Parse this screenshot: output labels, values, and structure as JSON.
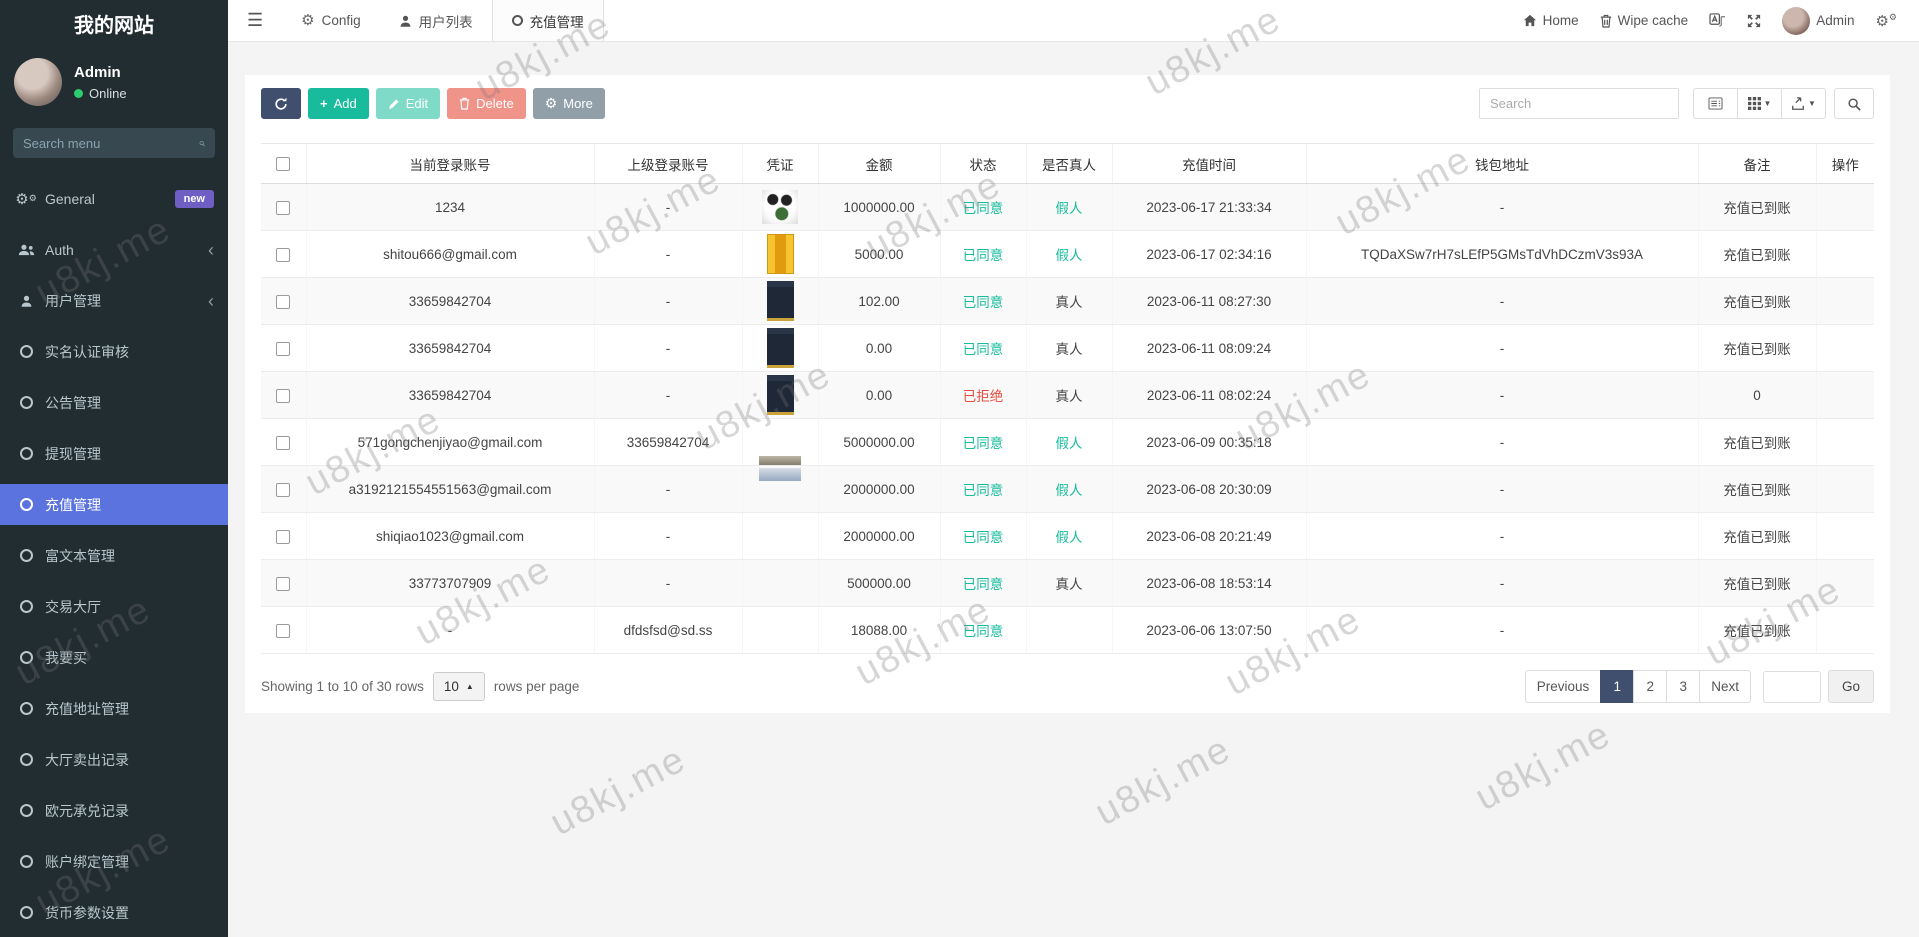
{
  "watermark": {
    "text": "u8kj.me"
  },
  "colors": {
    "sidebar_bg": "#222d32",
    "accent_active": "#5b73de",
    "teal": "#18bc9c",
    "red": "#e74c3c",
    "navy": "#414f6e",
    "badge_purple": "#6f5fc4",
    "online_green": "#2ecc71",
    "stripe": "#f9f9f9"
  },
  "sidebar": {
    "title": "我的网站",
    "user": {
      "name": "Admin",
      "status": "Online"
    },
    "search_placeholder": "Search menu",
    "items": [
      {
        "label": "General",
        "icon": "gears-icon",
        "badge": "new"
      },
      {
        "label": "Auth",
        "icon": "users-icon",
        "chevron": true
      },
      {
        "label": "用户管理",
        "icon": "user-icon",
        "chevron": true
      },
      {
        "label": "实名认证审核",
        "icon": "circle-icon"
      },
      {
        "label": "公告管理",
        "icon": "circle-icon"
      },
      {
        "label": "提现管理",
        "icon": "circle-icon"
      },
      {
        "label": "充值管理",
        "icon": "circle-icon",
        "active": true
      },
      {
        "label": "富文本管理",
        "icon": "circle-icon"
      },
      {
        "label": "交易大厅",
        "icon": "circle-icon"
      },
      {
        "label": "我要买",
        "icon": "circle-icon"
      },
      {
        "label": "充值地址管理",
        "icon": "circle-icon"
      },
      {
        "label": "大厅卖出记录",
        "icon": "circle-icon"
      },
      {
        "label": "欧元承兑记录",
        "icon": "circle-icon"
      },
      {
        "label": "账户绑定管理",
        "icon": "circle-icon"
      },
      {
        "label": "货币参数设置",
        "icon": "circle-icon"
      }
    ]
  },
  "navbar": {
    "tabs": [
      {
        "label": "Config",
        "icon": "gear-icon"
      },
      {
        "label": "用户列表",
        "icon": "user-icon"
      },
      {
        "label": "充值管理",
        "icon": "circle-icon",
        "active": true
      }
    ],
    "home": "Home",
    "wipe_cache": "Wipe cache",
    "username": "Admin"
  },
  "toolbar": {
    "add": "Add",
    "edit": "Edit",
    "delete": "Delete",
    "more": "More",
    "search_placeholder": "Search"
  },
  "table": {
    "columns": [
      "当前登录账号",
      "上级登录账号",
      "凭证",
      "金额",
      "状态",
      "是否真人",
      "充值时间",
      "钱包地址",
      "备注",
      "操作"
    ],
    "rows": [
      {
        "account": "1234",
        "parent": "-",
        "voucher": "panda",
        "amount": "1000000.00",
        "status": "已同意",
        "status_type": "approved",
        "real": "假人",
        "real_type": "fake",
        "time": "2023-06-17 21:33:34",
        "wallet": "-",
        "remark": "充值已到账",
        "action": ""
      },
      {
        "account": "shitou666@gmail.com",
        "parent": "-",
        "voucher": "gold-card",
        "amount": "5000.00",
        "status": "已同意",
        "status_type": "approved",
        "real": "假人",
        "real_type": "fake",
        "time": "2023-06-17 02:34:16",
        "wallet": "TQDaXSw7rH7sLEfP5GMsTdVhDCzmV3s93A",
        "remark": "充值已到账",
        "action": ""
      },
      {
        "account": "33659842704",
        "parent": "-",
        "voucher": "dark-card",
        "amount": "102.00",
        "status": "已同意",
        "status_type": "approved",
        "real": "真人",
        "real_type": "real",
        "time": "2023-06-11 08:27:30",
        "wallet": "-",
        "remark": "充值已到账",
        "action": ""
      },
      {
        "account": "33659842704",
        "parent": "-",
        "voucher": "dark-card",
        "amount": "0.00",
        "status": "已同意",
        "status_type": "approved",
        "real": "真人",
        "real_type": "real",
        "time": "2023-06-11 08:09:24",
        "wallet": "-",
        "remark": "充值已到账",
        "action": ""
      },
      {
        "account": "33659842704",
        "parent": "-",
        "voucher": "dark-card",
        "amount": "0.00",
        "status": "已拒绝",
        "status_type": "rejected",
        "real": "真人",
        "real_type": "real",
        "time": "2023-06-11 08:02:24",
        "wallet": "-",
        "remark": "0",
        "action": ""
      },
      {
        "account": "571gongchenjiyao@gmail.com",
        "parent": "33659842704",
        "voucher": "strip-bottom",
        "amount": "5000000.00",
        "status": "已同意",
        "status_type": "approved",
        "real": "假人",
        "real_type": "fake",
        "time": "2023-06-09 00:35:18",
        "wallet": "-",
        "remark": "充值已到账",
        "action": ""
      },
      {
        "account": "a3192121554551563@gmail.com",
        "parent": "-",
        "voucher": "strip-top",
        "amount": "2000000.00",
        "status": "已同意",
        "status_type": "approved",
        "real": "假人",
        "real_type": "fake",
        "time": "2023-06-08 20:30:09",
        "wallet": "-",
        "remark": "充值已到账",
        "action": ""
      },
      {
        "account": "shiqiao1023@gmail.com",
        "parent": "-",
        "voucher": "none",
        "amount": "2000000.00",
        "status": "已同意",
        "status_type": "approved",
        "real": "假人",
        "real_type": "fake",
        "time": "2023-06-08 20:21:49",
        "wallet": "-",
        "remark": "充值已到账",
        "action": ""
      },
      {
        "account": "33773707909",
        "parent": "-",
        "voucher": "none",
        "amount": "500000.00",
        "status": "已同意",
        "status_type": "approved",
        "real": "真人",
        "real_type": "real",
        "time": "2023-06-08 18:53:14",
        "wallet": "-",
        "remark": "充值已到账",
        "action": ""
      },
      {
        "account": "-",
        "parent": "dfdsfsd@sd.ss",
        "voucher": "none",
        "amount": "18088.00",
        "status": "已同意",
        "status_type": "approved",
        "real": "",
        "real_type": "",
        "time": "2023-06-06 13:07:50",
        "wallet": "-",
        "remark": "充值已到账",
        "action": ""
      }
    ]
  },
  "footer": {
    "showing": "Showing 1 to 10 of 30 rows",
    "page_size": "10",
    "rows_per_page_label": "rows per page",
    "prev": "Previous",
    "pages": [
      "1",
      "2",
      "3"
    ],
    "active_page": "1",
    "next": "Next",
    "go": "Go"
  }
}
